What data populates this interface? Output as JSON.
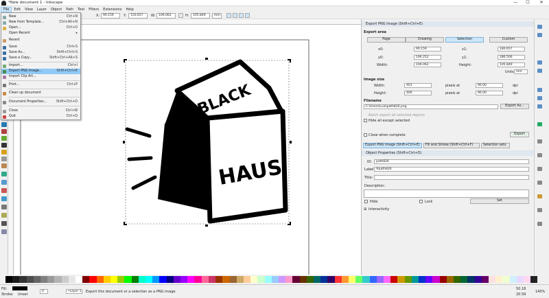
{
  "window": {
    "title": "*New document 1 - Inkscape",
    "controls": [
      "—",
      "☐",
      "✕"
    ]
  },
  "menubar": [
    "File",
    "Edit",
    "View",
    "Layer",
    "Object",
    "Path",
    "Text",
    "Filters",
    "Extensions",
    "Help"
  ],
  "cmdbar": {
    "x_label": "X:",
    "x": "90.159",
    "y_label": "Y:",
    "y": "150.657",
    "w_label": "W:",
    "w": "106.062",
    "h_label": "H:",
    "h": "105.849",
    "unit": "mm"
  },
  "filemenu": {
    "items": [
      {
        "label": "New",
        "shortcut": "Ctrl+N"
      },
      {
        "label": "New from Template...",
        "shortcut": "Ctrl+Alt+N"
      },
      {
        "label": "Open...",
        "shortcut": "Ctrl+O"
      },
      {
        "label": "Open Recent",
        "shortcut": "▸"
      },
      {
        "label": "Revert",
        "shortcut": ""
      },
      {
        "label": "Save",
        "shortcut": "Ctrl+S"
      },
      {
        "label": "Save As...",
        "shortcut": "Shift+Ctrl+S"
      },
      {
        "label": "Save a Copy...",
        "shortcut": "Shift+Ctrl+Alt+S"
      },
      {
        "label": "Import...",
        "shortcut": "Ctrl+I"
      },
      {
        "label": "Export PNG Image...",
        "shortcut": "Shift+Ctrl+E"
      },
      {
        "label": "Import Clip Art...",
        "shortcut": ""
      },
      {
        "label": "Print...",
        "shortcut": "Ctrl+P"
      },
      {
        "label": "Clean up document",
        "shortcut": ""
      },
      {
        "label": "Document Properties...",
        "shortcut": "Shift+Ctrl+D"
      },
      {
        "label": "Close",
        "shortcut": "Ctrl+W"
      },
      {
        "label": "Quit",
        "shortcut": "Ctrl+Q"
      }
    ]
  },
  "export": {
    "header": "Export PNG Image (Shift+Ctrl+E)",
    "area_title": "Export area",
    "area_buttons": [
      "Page",
      "Drawing",
      "Selection",
      "Custom"
    ],
    "x0_label": "x0:",
    "x0": "90.159",
    "x1_label": "x1:",
    "x1": "180.657",
    "y0_label": "y0:",
    "y0": "196.252",
    "y1_label": "y1:",
    "y1": "286.506",
    "width_label": "Width:",
    "width": "106.062",
    "height_label": "Height:",
    "height": "105.849",
    "units_label": "Units:",
    "units": "mm",
    "size_title": "Image size",
    "px_width": "401",
    "px_height": "400",
    "pixels_at": "pixels at",
    "dpi1": "96.00",
    "dpi2": "96.00",
    "dpi": "dpi",
    "filename_title": "Filename",
    "filename": "C:\\Users\\Luis\\path826.png",
    "export_as": "Export As...",
    "batch": "Batch export all selected objects",
    "hide": "Hide all except selected",
    "close_when": "Close when complete",
    "export_btn": "Export"
  },
  "tabs": [
    "Export PNG Image (Shift+Ctrl+E)",
    "Fill and Stroke (Shift+Ctrl+F)",
    "Selection sets"
  ],
  "objprops": {
    "header": "Object Properties (Shift+Ctrl+O)",
    "id_label": "ID:",
    "id": "path826",
    "label_label": "Label:",
    "label": "#path826",
    "title_label": "Title:",
    "desc_label": "Description:",
    "hide": "Hide",
    "lock": "Lock",
    "set": "Set",
    "interactivity": "Interactivity"
  },
  "artwork": {
    "top_text": "BLACK",
    "bottom_text": "HAUS"
  },
  "status": {
    "fill_label": "Fill:",
    "stroke_label": "Stroke:",
    "stroke_value": "Unset",
    "opacity": "0",
    "layer": "•Layer 1",
    "message": "Export this document or a selection as a PNG image",
    "x": "50.18",
    "y": "20.59",
    "zoom": "140%"
  },
  "colors": {
    "accent": "#91c9f7",
    "palette": [
      "#000000",
      "#1a1a1a",
      "#333333",
      "#4d4d4d",
      "#666666",
      "#808080",
      "#999999",
      "#b3b3b3",
      "#cccccc",
      "#e6e6e6",
      "#ffffff",
      "#800000",
      "#ff0000",
      "#ff6600",
      "#ffcc00",
      "#ffff00",
      "#99cc00",
      "#00ff00",
      "#008000",
      "#00ffcc",
      "#00ffff",
      "#0099ff",
      "#0000ff",
      "#000080",
      "#6600cc",
      "#9900ff",
      "#ff00ff",
      "#ff0099",
      "#ff6699",
      "#cc3366",
      "#993300",
      "#cc6600",
      "#996633",
      "#ccaa66",
      "#ffcc99",
      "#ffffcc",
      "#ccffcc",
      "#99ffff",
      "#99ccff",
      "#cc99ff",
      "#ff99cc",
      "#660033",
      "#663300",
      "#336600",
      "#006666",
      "#003399",
      "#330066",
      "#ff3333",
      "#ff9933",
      "#ffff66",
      "#66ff66",
      "#33cccc",
      "#3366ff",
      "#9966ff",
      "#ff66ff",
      "#cc0000",
      "#cc9900",
      "#669900",
      "#009999",
      "#0033cc",
      "#6600ff",
      "#cc00cc",
      "#990000",
      "#996600",
      "#336600",
      "#006633",
      "#003366",
      "#330099",
      "#660066",
      "#ffe0e0",
      "#fff0d0",
      "#f0ffd0",
      "#d0f0ff",
      "#e8d8ff",
      "#ffd8f0",
      "#222222"
    ]
  }
}
